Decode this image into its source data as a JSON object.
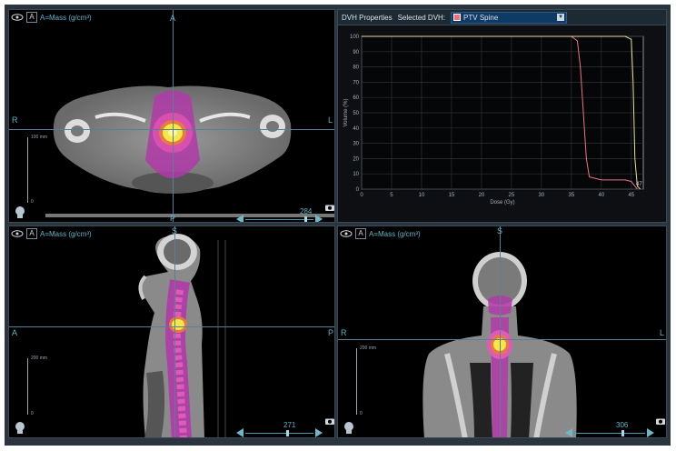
{
  "panes": {
    "axial": {
      "density_label": "A=Mass (g/cm³)",
      "top": "A",
      "left": "R",
      "right": "L",
      "bottom": "P",
      "scale_top": "100 mm",
      "scale_bottom": "0",
      "slice": "284"
    },
    "sagittal": {
      "density_label": "A=Mass (g/cm³)",
      "top": "S",
      "left": "A",
      "right": "P",
      "scale_top": "200 mm",
      "scale_bottom": "0",
      "slice": "271"
    },
    "coronal": {
      "density_label": "A=Mass (g/cm³)",
      "top": "S",
      "left": "R",
      "right": "L",
      "scale_top": "200 mm",
      "scale_bottom": "0",
      "slice": "306"
    }
  },
  "dvh": {
    "title": "DVH Properties",
    "selected_label": "Selected DVH:",
    "selected_value": "PTV Spine",
    "end_label": "47",
    "colors": {
      "curve_a": "#f0728a",
      "curve_b": "#e8e0a0"
    }
  },
  "chart_data": {
    "type": "line",
    "xlabel": "Dose (Gy)",
    "ylabel": "Volume (%)",
    "xlim": [
      0,
      47
    ],
    "ylim": [
      0,
      100
    ],
    "x_ticks": [
      0,
      5,
      10,
      15,
      20,
      25,
      30,
      35,
      40,
      45
    ],
    "y_ticks": [
      0,
      10,
      20,
      30,
      40,
      50,
      60,
      70,
      80,
      90,
      100
    ],
    "grid": true,
    "series": [
      {
        "x": [
          0,
          35,
          36,
          36.5,
          37,
          37.5,
          38,
          40,
          44,
          45,
          45.6,
          46
        ],
        "y": [
          100,
          100,
          97,
          80,
          50,
          20,
          8,
          6,
          6,
          5,
          2,
          0
        ]
      },
      {
        "x": [
          0,
          42,
          44,
          45,
          45.3,
          45.6,
          46,
          46.5
        ],
        "y": [
          100,
          100,
          100,
          98,
          70,
          20,
          2,
          0
        ]
      }
    ]
  },
  "icons": {
    "eye": "eye-icon",
    "head": "head-icon",
    "camera": "camera-icon"
  }
}
